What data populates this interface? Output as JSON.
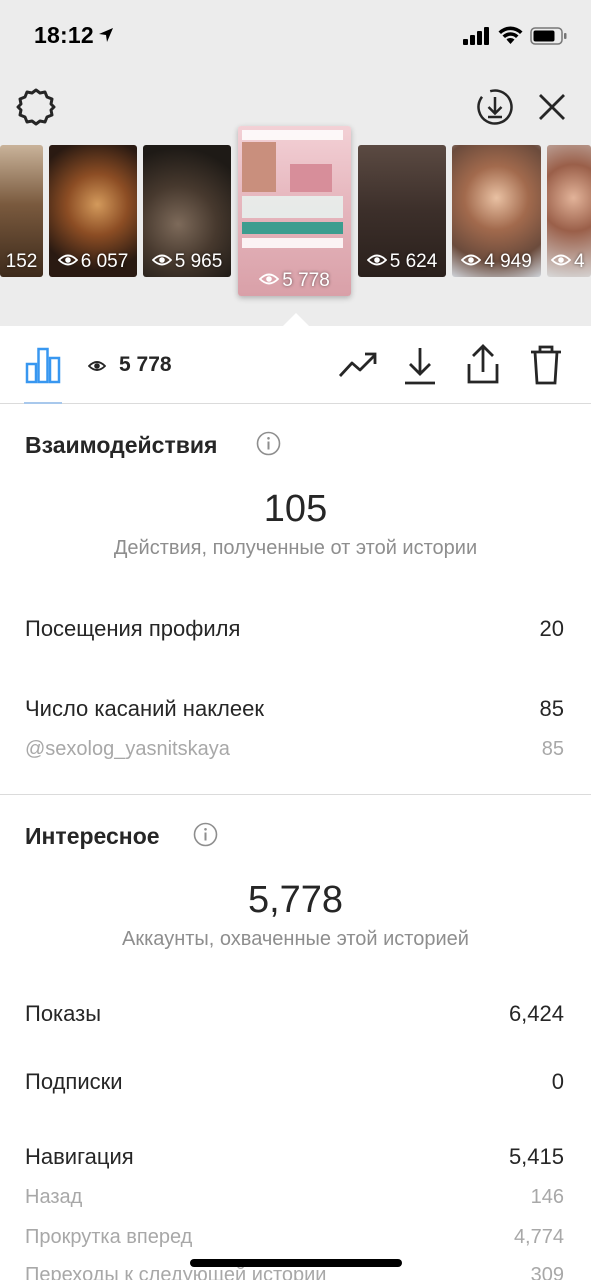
{
  "status": {
    "time": "18:12"
  },
  "thumbnails": [
    {
      "views": "152"
    },
    {
      "views": "6 057"
    },
    {
      "views": "5 965"
    },
    {
      "views": "5 778"
    },
    {
      "views": "5 624"
    },
    {
      "views": "4 949"
    },
    {
      "views": "4"
    }
  ],
  "toolbar": {
    "view_count": "5 778"
  },
  "interactions": {
    "title": "Взаимодействия",
    "total": "105",
    "total_caption": "Действия, полученные от этой истории",
    "rows": [
      {
        "label": "Посещения профиля",
        "value": "20"
      },
      {
        "label": "Число касаний наклеек",
        "value": "85"
      },
      {
        "label": "@sexolog_yasnitskaya",
        "value": "85"
      }
    ]
  },
  "discovery": {
    "title": "Интересное",
    "total": "5,778",
    "total_caption": "Аккаунты, охваченные этой историей",
    "rows": [
      {
        "label": "Показы",
        "value": "6,424"
      },
      {
        "label": "Подписки",
        "value": "0"
      },
      {
        "label": "Навигация",
        "value": "5,415"
      },
      {
        "label": "Назад",
        "value": "146"
      },
      {
        "label": "Прокрутка вперед",
        "value": "4,774"
      },
      {
        "label": "Переходы к следующей истории",
        "value": "309"
      }
    ]
  },
  "colors": {
    "accent": "#3897f0",
    "text": "#262626",
    "muted": "#8e8e8e",
    "header_bg": "#ececec"
  },
  "icons": [
    "location-arrow-icon",
    "signal-icon",
    "wifi-icon",
    "battery-icon",
    "settings-icon",
    "download-circle-icon",
    "close-icon",
    "eye-icon",
    "bar-chart-icon",
    "trending-icon",
    "download-icon",
    "share-icon",
    "trash-icon",
    "info-icon"
  ]
}
